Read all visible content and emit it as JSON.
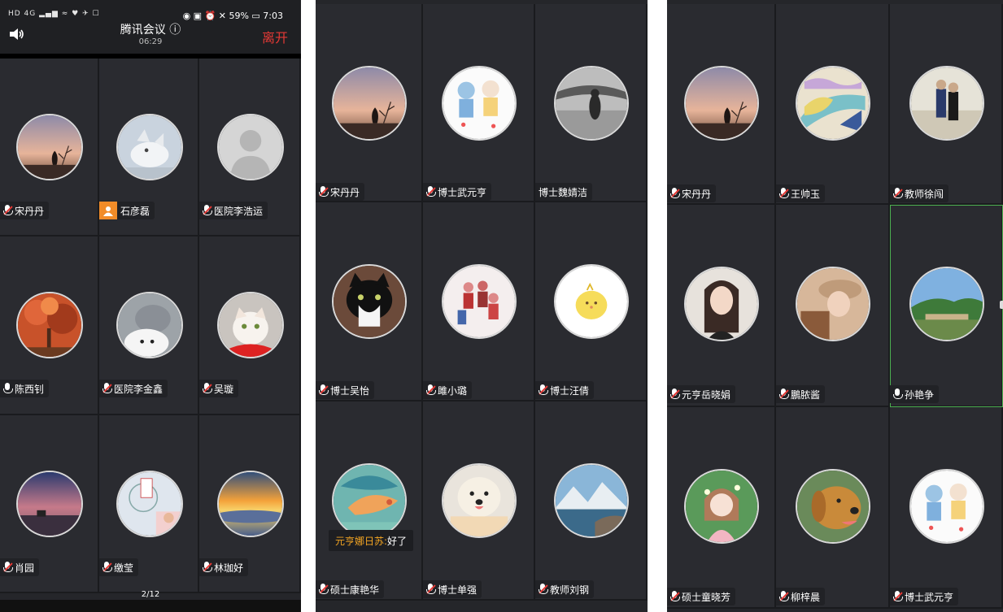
{
  "status": {
    "left": "HD 4G ▂▄▆ ≈ ♥ ✈ ☐",
    "battery": "59%",
    "time": "7:03"
  },
  "meeting": {
    "title": "腾讯会议",
    "info_icon": "ⓘ",
    "elapsed": "06:29",
    "leave_label": "离开",
    "page_indicator": "2/12"
  },
  "chat": {
    "sender": "元亨娜日苏:",
    "text": "好了"
  },
  "panels": [
    {
      "participants": [
        {
          "name": "宋丹丹",
          "mic": "muted",
          "avatar": "sunset-silhouette"
        },
        {
          "name": "石彦磊",
          "mic": "host",
          "avatar": "white-fox"
        },
        {
          "name": "医院李浩运",
          "mic": "muted",
          "avatar": "default-person"
        },
        {
          "name": "陈西钊",
          "mic": "on",
          "avatar": "autumn-tree"
        },
        {
          "name": "医院李金鑫",
          "mic": "muted",
          "avatar": "cats"
        },
        {
          "name": "吴璇",
          "mic": "muted",
          "avatar": "white-cat"
        },
        {
          "name": "肖园",
          "mic": "muted",
          "avatar": "dusk-field"
        },
        {
          "name": "缴莹",
          "mic": "muted",
          "avatar": "ferris-wheel"
        },
        {
          "name": "林珈好",
          "mic": "muted",
          "avatar": "sea-sunset"
        }
      ]
    },
    {
      "participants": [
        {
          "name": "宋丹丹",
          "mic": "muted",
          "avatar": "sunset-silhouette"
        },
        {
          "name": "博士武元亨",
          "mic": "muted",
          "avatar": "cartoon-kids"
        },
        {
          "name": "博士魏婧洁",
          "mic": "none",
          "avatar": "bw-person"
        },
        {
          "name": "博士吴怡",
          "mic": "muted",
          "avatar": "tuxedo-cat"
        },
        {
          "name": "雎小璐",
          "mic": "muted",
          "avatar": "people-group"
        },
        {
          "name": "博士汪倩",
          "mic": "muted",
          "avatar": "yellow-chick"
        },
        {
          "name": "硕士康艳华",
          "mic": "muted",
          "avatar": "flying-bird"
        },
        {
          "name": "博士单强",
          "mic": "muted",
          "avatar": "samoyed-dog"
        },
        {
          "name": "教师刘钢",
          "mic": "muted",
          "avatar": "mountain-lake"
        }
      ]
    },
    {
      "participants": [
        {
          "name": "宋丹丹",
          "mic": "muted",
          "avatar": "sunset-silhouette"
        },
        {
          "name": "王帅玉",
          "mic": "muted",
          "avatar": "painting"
        },
        {
          "name": "教师徐闯",
          "mic": "muted",
          "avatar": "couple-outdoor"
        },
        {
          "name": "元亨岳晓娟",
          "mic": "muted",
          "avatar": "girl-portrait"
        },
        {
          "name": "鵬脓酱",
          "mic": "muted",
          "avatar": "woman-hat"
        },
        {
          "name": "孙艳争",
          "mic": "on",
          "avatar": "park-landscape",
          "active": true
        },
        {
          "name": "硕士童晓芳",
          "mic": "muted",
          "avatar": "cartoon-girl"
        },
        {
          "name": "柳梓晨",
          "mic": "muted",
          "avatar": "golden-retriever"
        },
        {
          "name": "博士武元亨",
          "mic": "muted",
          "avatar": "cartoon-kids"
        }
      ]
    }
  ],
  "colors": {
    "leave": "#e53935",
    "host": "#f28c28",
    "active_border": "#4caf50",
    "chat_sender": "#f5a623"
  }
}
